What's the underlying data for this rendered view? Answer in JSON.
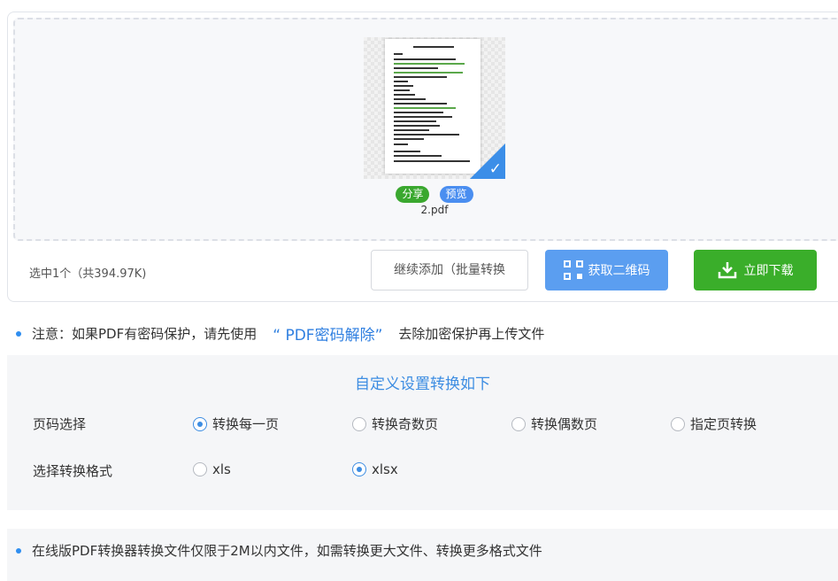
{
  "file": {
    "name": "2.pdf",
    "share_label": "分享",
    "preview_label": "预览",
    "check_glyph": "✓"
  },
  "selection_info": "选中1个（共394.97K)",
  "buttons": {
    "continue": "继续添加（批量转换",
    "qr": "获取二维码",
    "download": "立即下载"
  },
  "notice": {
    "prefix": "注意：如果PDF有密码保护，请先使用",
    "link": "“ PDF密码解除”",
    "suffix": "去除加密保护再上传文件"
  },
  "settings": {
    "title": "自定义设置转换如下",
    "page_select": {
      "label": "页码选择",
      "options": [
        "转换每一页",
        "转换奇数页",
        "转换偶数页",
        "指定页转换"
      ],
      "selected": "转换每一页"
    },
    "format_select": {
      "label": "选择转换格式",
      "options": [
        "xls",
        "xlsx"
      ],
      "selected": "xlsx"
    }
  },
  "footer_notice": "在线版PDF转换器转换文件仅限于2M以内文件，如需转换更大文件、转换更多格式文件",
  "colors": {
    "accent": "#3d8de2",
    "share": "#3aa82f",
    "preview": "#4a8ef0",
    "qr_button": "#5b9ef0",
    "download_button": "#3aae2a"
  },
  "icons": [
    "check-icon",
    "qr-code-icon",
    "download-icon",
    "bullet-dot-icon"
  ]
}
